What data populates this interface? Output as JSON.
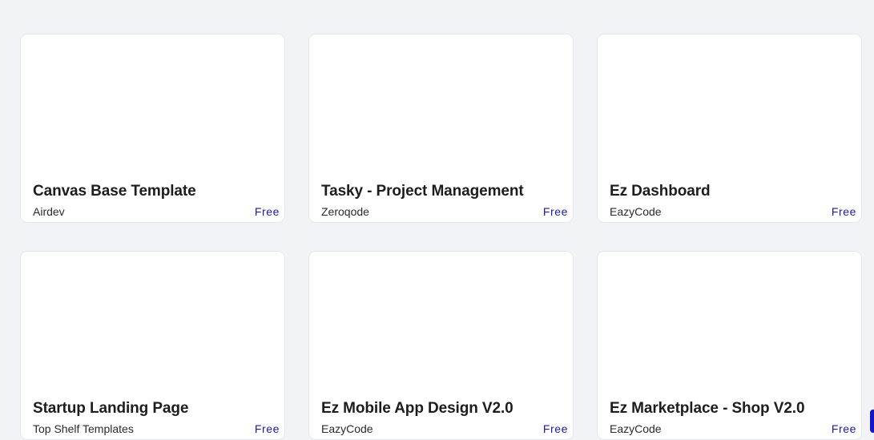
{
  "templates": [
    {
      "title": "Canvas Base Template",
      "author": "Airdev",
      "price": "Free"
    },
    {
      "title": "Tasky - Project Management",
      "author": "Zeroqode",
      "price": "Free"
    },
    {
      "title": "Ez Dashboard",
      "author": "EazyCode",
      "price": "Free"
    },
    {
      "title": "Startup Landing Page",
      "author": "Top Shelf Templates",
      "price": "Free"
    },
    {
      "title": "Ez Mobile App Design V2.0",
      "author": "EazyCode",
      "price": "Free"
    },
    {
      "title": "Ez Marketplace - Shop V2.0",
      "author": "EazyCode",
      "price": "Free"
    }
  ],
  "colors": {
    "background": "#f2f3f6",
    "card": "#ffffff",
    "price_accent": "#1a1ab8",
    "widget_accent": "#1414c8"
  }
}
